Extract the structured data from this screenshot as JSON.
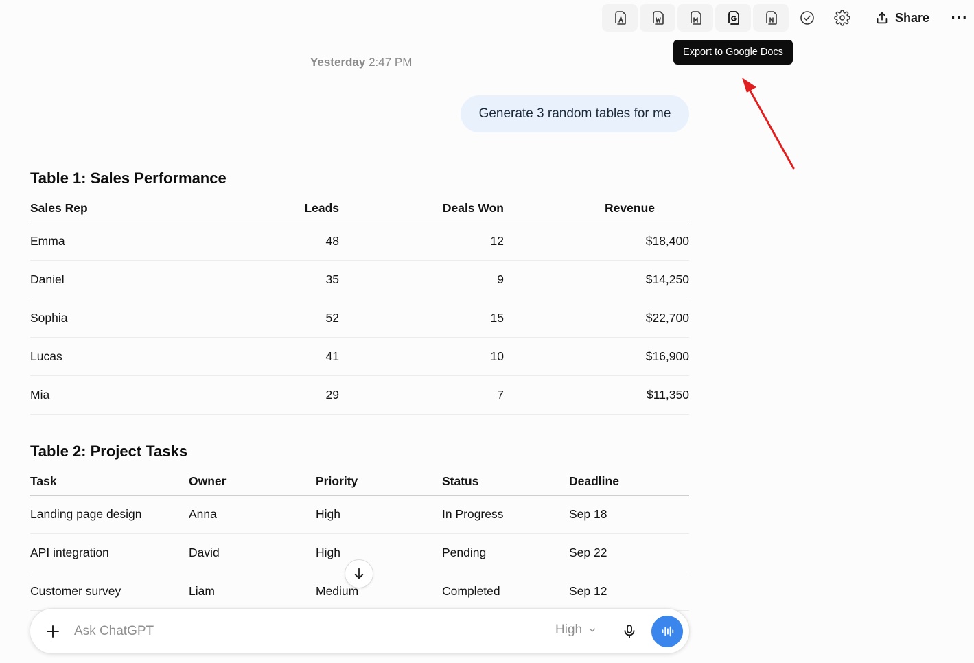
{
  "toolbar": {
    "buttons": [
      {
        "name": "export-pdf-icon",
        "letter": "A"
      },
      {
        "name": "export-word-icon",
        "letter": "W"
      },
      {
        "name": "export-markdown-icon",
        "letter": "M"
      },
      {
        "name": "export-google-docs-icon",
        "letter": "G"
      },
      {
        "name": "export-notion-icon",
        "letter": "N"
      }
    ],
    "share_label": "Share",
    "more_label": "···"
  },
  "tooltip": "Export to Google Docs",
  "conversation": {
    "timestamp_day": "Yesterday",
    "timestamp_time": "2:47 PM",
    "user_message": "Generate 3 random tables for me"
  },
  "table1": {
    "title": "Table 1: Sales Performance",
    "headers": [
      "Sales Rep",
      "Leads",
      "Deals Won",
      "Revenue"
    ],
    "rows": [
      [
        "Emma",
        "48",
        "12",
        "$18,400"
      ],
      [
        "Daniel",
        "35",
        "9",
        "$14,250"
      ],
      [
        "Sophia",
        "52",
        "15",
        "$22,700"
      ],
      [
        "Lucas",
        "41",
        "10",
        "$16,900"
      ],
      [
        "Mia",
        "29",
        "7",
        "$11,350"
      ]
    ]
  },
  "table2": {
    "title": "Table 2: Project Tasks",
    "headers": [
      "Task",
      "Owner",
      "Priority",
      "Status",
      "Deadline"
    ],
    "rows": [
      [
        "Landing page design",
        "Anna",
        "High",
        "In Progress",
        "Sep 18"
      ],
      [
        "API integration",
        "David",
        "High",
        "Pending",
        "Sep 22"
      ],
      [
        "Customer survey",
        "Liam",
        "Medium",
        "Completed",
        "Sep 12"
      ]
    ]
  },
  "composer": {
    "placeholder": "Ask ChatGPT",
    "model_label": "High"
  },
  "colors": {
    "accent": "#3b86ec",
    "user_bubble": "#e9f1fd",
    "annotation_arrow": "#e02020"
  }
}
